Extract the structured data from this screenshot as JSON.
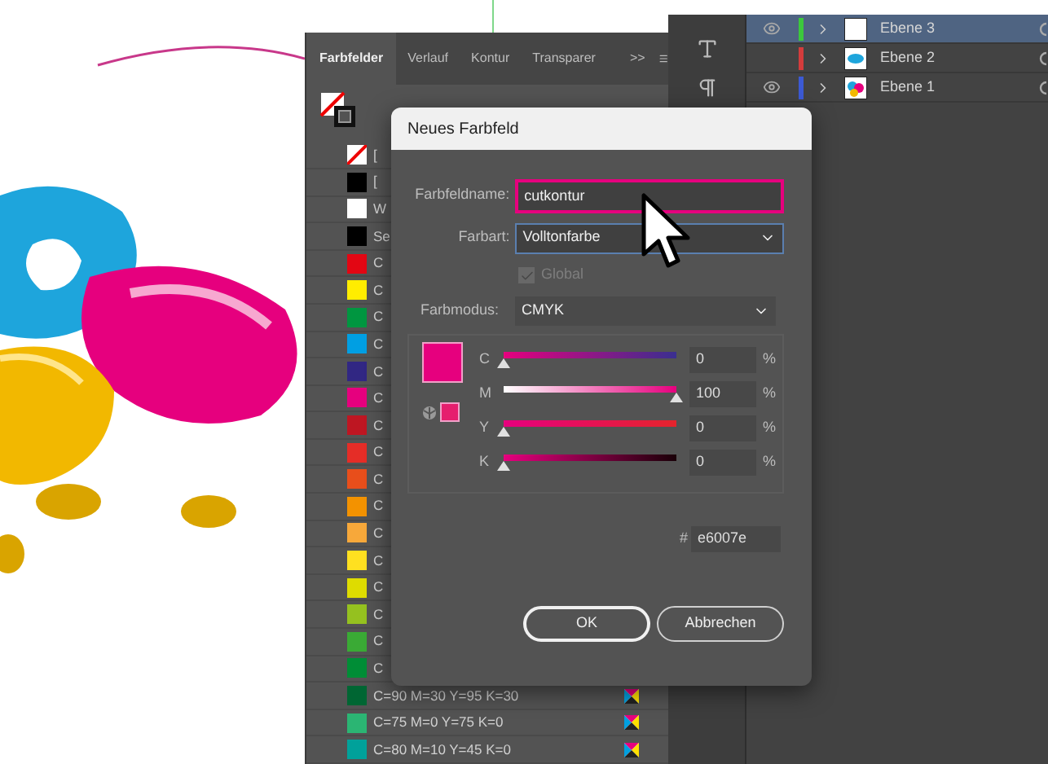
{
  "swatches_panel": {
    "tabs": [
      {
        "label": "Farbfelder",
        "selected": true
      },
      {
        "label": "Verlauf",
        "selected": false
      },
      {
        "label": "Kontur",
        "selected": false
      },
      {
        "label": "Transparer",
        "selected": false
      }
    ],
    "overflow": ">>",
    "swatches": [
      {
        "kind": "none",
        "name": "[",
        "color": "#ffffff"
      },
      {
        "kind": "color",
        "name": "[",
        "color": "#000000"
      },
      {
        "kind": "color",
        "name": "W",
        "color": "#ffffff"
      },
      {
        "kind": "color",
        "name": "Se",
        "color": "#000000"
      },
      {
        "kind": "color",
        "name": "C",
        "color": "#e30613"
      },
      {
        "kind": "color",
        "name": "C",
        "color": "#ffed00"
      },
      {
        "kind": "color",
        "name": "C",
        "color": "#009640"
      },
      {
        "kind": "color",
        "name": "C",
        "color": "#009fe3"
      },
      {
        "kind": "color",
        "name": "C",
        "color": "#312783"
      },
      {
        "kind": "color",
        "name": "C",
        "color": "#e6007e"
      },
      {
        "kind": "color",
        "name": "C",
        "color": "#be1622"
      },
      {
        "kind": "color",
        "name": "C",
        "color": "#e52d27"
      },
      {
        "kind": "color",
        "name": "C",
        "color": "#e84e1b"
      },
      {
        "kind": "color",
        "name": "C",
        "color": "#f39200"
      },
      {
        "kind": "color",
        "name": "C",
        "color": "#f7a83a"
      },
      {
        "kind": "color",
        "name": "C",
        "color": "#ffe020"
      },
      {
        "kind": "color",
        "name": "C",
        "color": "#dedc00"
      },
      {
        "kind": "color",
        "name": "C",
        "color": "#95c11f"
      },
      {
        "kind": "color",
        "name": "C",
        "color": "#3aaa35"
      },
      {
        "kind": "color",
        "name": "C",
        "color": "#008d36"
      },
      {
        "kind": "color",
        "name": "C=90 M=30 Y=95 K=30",
        "color": "#006633",
        "type_icon": true
      },
      {
        "kind": "color",
        "name": "C=75 M=0 Y=75 K=0",
        "color": "#2bb573",
        "type_icon": true
      },
      {
        "kind": "color",
        "name": "C=80 M=10 Y=45 K=0",
        "color": "#00a19a",
        "type_icon": true
      }
    ]
  },
  "layers": [
    {
      "name": "Ebene 3",
      "visible": true,
      "selected": true,
      "color": "#3cc83c"
    },
    {
      "name": "Ebene 2",
      "visible": false,
      "selected": false,
      "color": "#d43c3c"
    },
    {
      "name": "Ebene 1",
      "visible": true,
      "selected": false,
      "color": "#3c5ad4"
    }
  ],
  "dialog": {
    "title": "Neues Farbfeld",
    "name_label": "Farbfeldname:",
    "name_value": "cutkontur",
    "type_label": "Farbart:",
    "type_value": "Volltonfarbe",
    "global": {
      "label": "Global",
      "checked": true,
      "disabled": true
    },
    "mode_label": "Farbmodus:",
    "mode_value": "CMYK",
    "color": "#e6007e",
    "sliders": [
      {
        "label": "C",
        "level": 0,
        "value": "0",
        "unit": "%"
      },
      {
        "label": "M",
        "level": 1,
        "value": "100",
        "unit": "%"
      },
      {
        "label": "Y",
        "level": 0,
        "value": "0",
        "unit": "%"
      },
      {
        "label": "K",
        "level": 0,
        "value": "0",
        "unit": "%"
      }
    ],
    "hex": {
      "label": "#",
      "value": "e6007e"
    },
    "buttons": [
      {
        "label": "OK",
        "kind": "primary"
      },
      {
        "label": "Abbrechen",
        "kind": "secondary"
      }
    ]
  }
}
